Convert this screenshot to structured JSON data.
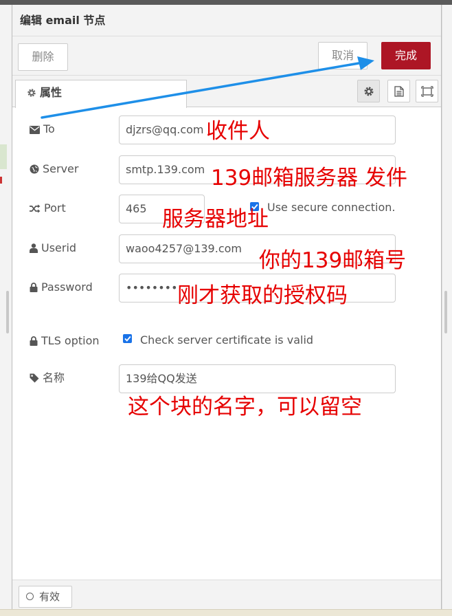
{
  "dialog": {
    "title": "编辑 email 节点",
    "buttons": {
      "delete": "删除",
      "cancel": "取消",
      "done": "完成"
    },
    "tabs": {
      "properties": "属性"
    }
  },
  "fields": {
    "to": {
      "label": "To",
      "value": "djzrs@qq.com"
    },
    "server": {
      "label": "Server",
      "value": "smtp.139.com"
    },
    "port": {
      "label": "Port",
      "value": "465",
      "secure_label": "Use secure connection.",
      "secure_checked": true
    },
    "userid": {
      "label": "Userid",
      "value": "waoo4257@139.com"
    },
    "password": {
      "label": "Password",
      "value": "••••••••"
    },
    "tls": {
      "label": "TLS option",
      "checkbox_label": "Check server certificate is valid",
      "checked": true
    },
    "name": {
      "label": "名称",
      "value": "139给QQ发送"
    }
  },
  "footer": {
    "enabled_label": "有效"
  },
  "annotations": {
    "recipient": "收件人",
    "server": "139邮箱服务器 发件",
    "port": "服务器地址",
    "userid": "你的139邮箱号",
    "password": "刚才获取的授权码",
    "name": "这个块的名字，可以留空"
  },
  "colors": {
    "done_button": "#ad1625",
    "checkbox": "#1a73e8",
    "annotation_text": "#e60000",
    "arrow": "#1e8fe8"
  }
}
